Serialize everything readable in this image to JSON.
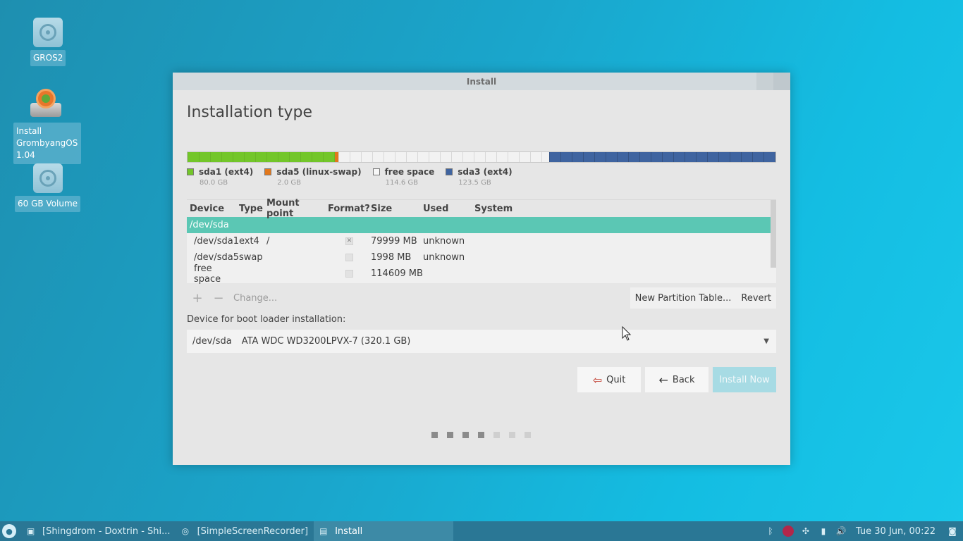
{
  "desktop": {
    "icons": [
      {
        "label": "GROS2",
        "icon": "drive-icon"
      },
      {
        "label": "Install\nGrombyangOS\n1.04",
        "icon": "installer-icon"
      },
      {
        "label": "60 GB Volume",
        "icon": "drive-icon"
      }
    ]
  },
  "window": {
    "title": "Install",
    "page_title": "Installation type",
    "partitions_legend": [
      {
        "name": "sda1 (ext4)",
        "size": "80.0 GB",
        "color": "#73c62a"
      },
      {
        "name": "sda5 (linux-swap)",
        "size": "2.0 GB",
        "color": "#e2781c"
      },
      {
        "name": "free space",
        "size": "114.6 GB",
        "color": "#f2f2f2"
      },
      {
        "name": "sda3 (ext4)",
        "size": "123.5 GB",
        "color": "#3f64a0"
      }
    ],
    "table": {
      "headers": [
        "Device",
        "Type",
        "Mount point",
        "Format?",
        "Size",
        "Used",
        "System"
      ],
      "rows": [
        {
          "device": "/dev/sda",
          "type": "",
          "mount": "",
          "format": null,
          "size": "",
          "used": "",
          "system": ""
        },
        {
          "device": "/dev/sda1",
          "type": "ext4",
          "mount": "/",
          "format": true,
          "size": "79999 MB",
          "used": "unknown",
          "system": ""
        },
        {
          "device": "/dev/sda5",
          "type": "swap",
          "mount": "",
          "format": false,
          "size": "1998 MB",
          "used": "unknown",
          "system": ""
        },
        {
          "device": "free space",
          "type": "",
          "mount": "",
          "format": false,
          "size": "114609 MB",
          "used": "",
          "system": ""
        }
      ]
    },
    "toolbar": {
      "add": "+",
      "remove": "−",
      "change": "Change...",
      "new_table": "New Partition Table...",
      "revert": "Revert"
    },
    "bootloader": {
      "label": "Device for boot loader installation:",
      "device": "/dev/sda",
      "model": "ATA WDC WD3200LPVX-7 (320.1 GB)"
    },
    "buttons": {
      "quit": "Quit",
      "back": "Back",
      "install": "Install Now"
    },
    "pager": {
      "total": 7,
      "active": 4
    }
  },
  "taskbar": {
    "tasks": [
      {
        "label": "[Shingdrom - Doxtrin - Shi...",
        "icon": "terminal-icon",
        "active": false
      },
      {
        "label": "[SimpleScreenRecorder]",
        "icon": "camera-icon",
        "active": false
      },
      {
        "label": "Install",
        "icon": "installer-icon",
        "active": true
      }
    ],
    "clock": "Tue 30 Jun, 00:22"
  }
}
